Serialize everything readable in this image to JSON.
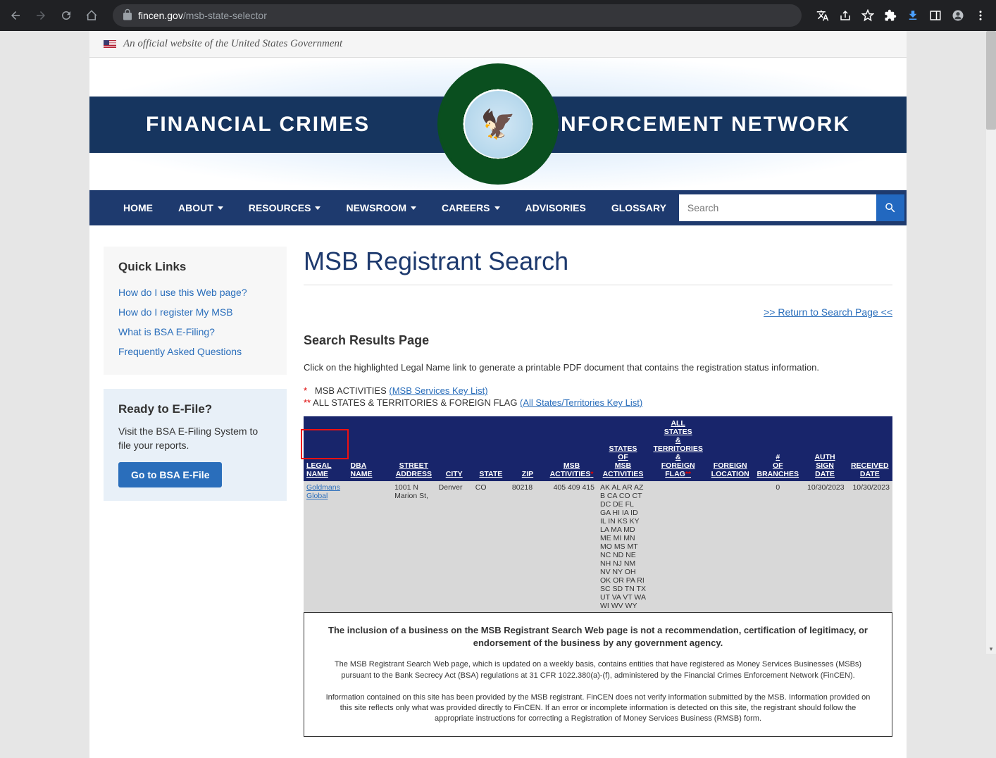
{
  "browser": {
    "url_domain": "fincen.gov",
    "url_path": "/msb-state-selector"
  },
  "official_banner": "An official website of the United States Government",
  "hero": {
    "left": "FINANCIAL CRIMES",
    "right": "ENFORCEMENT NETWORK",
    "seal_emoji": "🦅"
  },
  "nav": {
    "items": [
      {
        "label": "HOME",
        "dropdown": false
      },
      {
        "label": "ABOUT",
        "dropdown": true
      },
      {
        "label": "RESOURCES",
        "dropdown": true
      },
      {
        "label": "NEWSROOM",
        "dropdown": true
      },
      {
        "label": "CAREERS",
        "dropdown": true
      },
      {
        "label": "ADVISORIES",
        "dropdown": false
      },
      {
        "label": "GLOSSARY",
        "dropdown": false
      }
    ],
    "search_placeholder": "Search"
  },
  "sidebar": {
    "quick_links_title": "Quick Links",
    "quick_links": [
      "How do I use this Web page?",
      "How do I register My MSB",
      "What is BSA E-Filing?",
      "Frequently Asked Questions"
    ],
    "efile_title": "Ready to E-File?",
    "efile_desc": "Visit the BSA E-Filing System to file your reports.",
    "efile_btn": "Go to BSA E-File"
  },
  "content": {
    "page_title": "MSB Registrant Search",
    "return_link": ">> Return to Search Page <<",
    "sub_title": "Search Results Page",
    "instruction": "Click on the highlighted Legal Name link to generate a printable PDF document that contains the registration status information.",
    "legend1_label": "MSB ACTIVITIES ",
    "legend1_link": "(MSB Services Key List)",
    "legend2_label": "ALL STATES & TERRITORIES & FOREIGN FLAG ",
    "legend2_link": "(All States/Territories Key List)",
    "columns": [
      "LEGAL NAME",
      "DBA NAME",
      "STREET ADDRESS",
      "CITY",
      "STATE",
      "ZIP",
      "MSB ACTIVITIES",
      "STATES OF MSB ACTIVITIES",
      "ALL STATES & TERRITORIES & FOREIGN FLAG",
      "FOREIGN LOCATION",
      "# OF BRANCHES",
      "AUTH SIGN DATE",
      "RECEIVED DATE"
    ],
    "rows": [
      {
        "legal_name": "Goldmans Global",
        "dba": "",
        "street": "1001 N Marion St,",
        "city": "Denver",
        "state": "CO",
        "zip": "80218",
        "msb_activities": "405 409 415",
        "states_of": "AK AL AR AZ B CA CO CT DC DE FL GA HI IA ID IL IN KS KY LA MA MD ME MI MN MO MS MT NC ND NE NH NJ NM NV NY OH OK OR PA RI SC SD TN TX UT VA VT WA WI WV WY",
        "all_states_flag": "",
        "foreign": "",
        "branches": "0",
        "auth_date": "10/30/2023",
        "received_date": "10/30/2023"
      }
    ],
    "disclaimer": {
      "bold": "The inclusion of a business on the MSB Registrant Search Web page is not a recommendation, certification of legitimacy, or endorsement of the business by any government agency.",
      "p1": "The MSB Registrant Search Web page, which is updated on a weekly basis, contains entities that have registered as Money Services Businesses (MSBs) pursuant to the Bank Secrecy Act (BSA) regulations at 31 CFR 1022.380(a)-(f), administered by the Financial Crimes Enforcement Network (FinCEN).",
      "p2": "Information contained on this site has been provided by the MSB registrant. FinCEN does not verify information submitted by the MSB. Information provided on this site reflects only what was provided directly to FinCEN. If an error or incomplete information is detected on this site, the registrant should follow the appropriate instructions for correcting a Registration of Money Services Business (RMSB) form."
    }
  }
}
